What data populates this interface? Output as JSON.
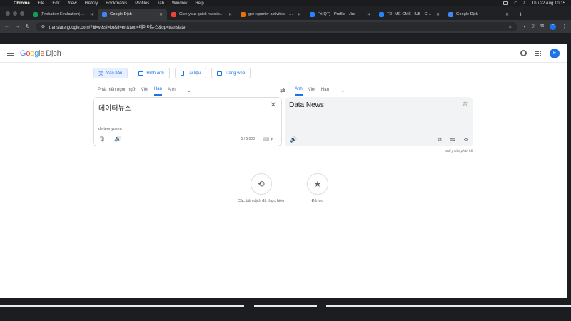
{
  "menubar": {
    "app": "Chrome",
    "items": [
      "File",
      "Edit",
      "View",
      "History",
      "Bookmarks",
      "Profiles",
      "Tab",
      "Window",
      "Help"
    ],
    "clock": "Thu 22 Aug 10:15"
  },
  "tabs": [
    {
      "title": "[Probation Evaluation] Fri Q...",
      "color": "#0f9d58"
    },
    {
      "title": "Google Dịch",
      "color": "#4285f4",
      "active": true
    },
    {
      "title": "Give your quick reaction usin...",
      "color": "#ea4335"
    },
    {
      "title": "get reporter activities - TDI-...",
      "color": "#e8710a"
    },
    {
      "title": "Fri(QT) - Profile - Jira",
      "color": "#2684ff"
    },
    {
      "title": "TDI-MC-CMS-HUB - Confluen...",
      "color": "#2684ff"
    },
    {
      "title": "Google Dịch",
      "color": "#4285f4"
    }
  ],
  "toolbar": {
    "url": "translate.google.com/?hl=vi&sl=ko&tl=en&text=데이터뉴스&op=translate",
    "profile_initial": "F"
  },
  "header": {
    "logo_google": "Google",
    "logo_dich": "Dịch",
    "account_initial": "F",
    "logo_colors": [
      "#4285f4",
      "#ea4335",
      "#fbbc05",
      "#4285f4",
      "#34a853",
      "#ea4335"
    ]
  },
  "modes": [
    {
      "label": "Văn bản",
      "icon": "translate-icon",
      "active": true
    },
    {
      "label": "Hình ảnh",
      "icon": "image-icon"
    },
    {
      "label": "Tài liệu",
      "icon": "document-icon"
    },
    {
      "label": "Trang web",
      "icon": "web-icon"
    }
  ],
  "source_langs": [
    "Phát hiện ngôn ngữ",
    "Việt",
    "Hàn",
    "Anh"
  ],
  "source_active": "Hàn",
  "target_langs": [
    "Anh",
    "Việt",
    "Hàn"
  ],
  "target_active": "Anh",
  "source": {
    "text": "데이터뉴스",
    "romanization": "deiteonyuseu",
    "char_count": "5 / 5.000"
  },
  "target": {
    "text": "Data News"
  },
  "feedback": "Gửi ý kiến phản hồi",
  "history_label": "Các bản dịch đã thực hiện",
  "saved_label": "Đã lưu"
}
